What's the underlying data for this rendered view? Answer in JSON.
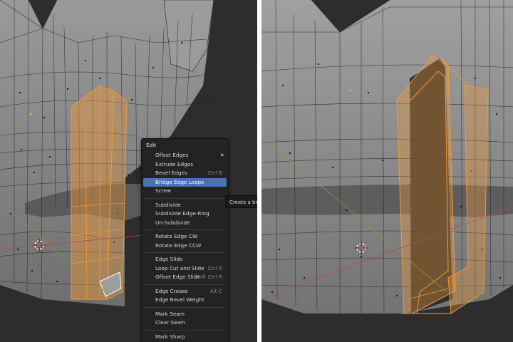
{
  "menu": {
    "title": "Edit",
    "sections": [
      [
        {
          "label": "Offset Edges",
          "submenu": true
        },
        {
          "label": "Extrude Edges"
        },
        {
          "label": "Bevel Edges",
          "shortcut": "Ctrl B"
        },
        {
          "label": "Bridge Edge Loops",
          "active": true
        },
        {
          "label": "Screw"
        }
      ],
      [
        {
          "label": "Subdivide"
        },
        {
          "label": "Subdivide Edge-Ring"
        },
        {
          "label": "Un-Subdivide"
        }
      ],
      [
        {
          "label": "Rotate Edge CW"
        },
        {
          "label": "Rotate Edge CCW"
        }
      ],
      [
        {
          "label": "Edge Slide"
        },
        {
          "label": "Loop Cut and Slide",
          "shortcut": "Ctrl R"
        },
        {
          "label": "Offset Edge Slide",
          "shortcut": "Shift Ctrl R"
        }
      ],
      [
        {
          "label": "Edge Crease",
          "shortcut": "Alt C"
        },
        {
          "label": "Edge Bevel Weight"
        }
      ],
      [
        {
          "label": "Mark Seam"
        },
        {
          "label": "Clear Seam"
        }
      ],
      [
        {
          "label": "Mark Sharp"
        }
      ]
    ]
  },
  "tooltip": {
    "text": "Create a bridge of faces betwe"
  },
  "colors": {
    "viewport_bg": "#2b2b2b",
    "mesh_face": "#8a8a8a",
    "wire": "#1e1e1e",
    "selection": "#f29a38",
    "menu_highlight": "#4772b3"
  }
}
